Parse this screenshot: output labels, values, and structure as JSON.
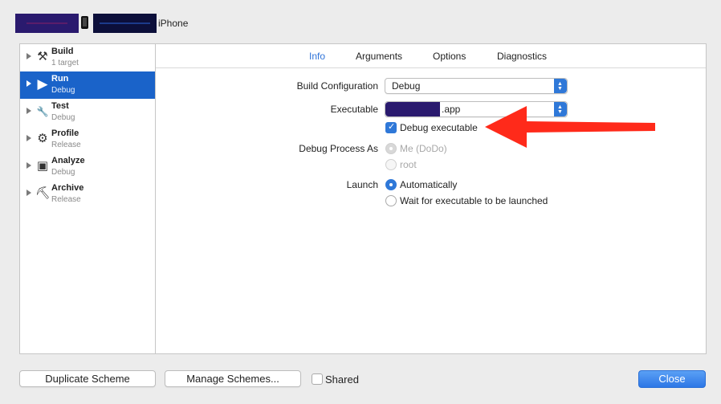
{
  "toolbar": {
    "device_label": "iPhone"
  },
  "sidebar": {
    "items": [
      {
        "name": "Build",
        "sub": "1 target",
        "icon": "hammer-icon",
        "glyph": "⚒"
      },
      {
        "name": "Run",
        "sub": "Debug",
        "icon": "play-icon",
        "glyph": "▶"
      },
      {
        "name": "Test",
        "sub": "Debug",
        "icon": "wrench-icon",
        "glyph": "🔧"
      },
      {
        "name": "Profile",
        "sub": "Release",
        "icon": "instruments-icon",
        "glyph": "⚙"
      },
      {
        "name": "Analyze",
        "sub": "Debug",
        "icon": "analyze-icon",
        "glyph": "▣"
      },
      {
        "name": "Archive",
        "sub": "Release",
        "icon": "archive-icon",
        "glyph": "⛏"
      }
    ]
  },
  "tabs": {
    "info": "Info",
    "arguments": "Arguments",
    "options": "Options",
    "diagnostics": "Diagnostics"
  },
  "info": {
    "build_configuration_label": "Build Configuration",
    "build_configuration_value": "Debug",
    "executable_label": "Executable",
    "executable_value": ".app",
    "debug_executable_label": "Debug executable",
    "debug_process_as_label": "Debug Process As",
    "process_me": "Me (DoDo)",
    "process_root": "root",
    "launch_label": "Launch",
    "launch_auto": "Automatically",
    "launch_wait": "Wait for executable to be launched"
  },
  "footer": {
    "duplicate_scheme": "Duplicate Scheme",
    "manage_schemes": "Manage Schemes...",
    "shared": "Shared",
    "close": "Close"
  },
  "colors": {
    "accent": "#2f78d8",
    "selection": "#1a63c9",
    "arrow": "#ff2a1a"
  }
}
